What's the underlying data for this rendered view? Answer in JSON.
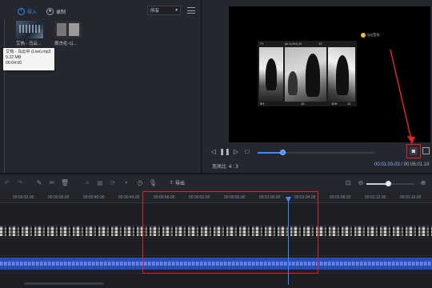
{
  "media": {
    "tabs": [
      {
        "label": "导入",
        "icon": "plus-circle-icon"
      },
      {
        "label": "录制",
        "icon": "record-circle-icon"
      }
    ],
    "filter": {
      "value": "所有",
      "icon": "chevron-down-icon"
    },
    "items": [
      {
        "name": "艾热 - 乌云..."
      },
      {
        "name": "周杰伦-以..."
      }
    ],
    "tooltip": {
      "filename": "艾热 - 乌云中 (Live).mp3",
      "size": "9.22 MB",
      "duration": "00:04:00"
    }
  },
  "preview": {
    "frame_captions": [
      "77",
      "(8-1) KO) N",
      "12",
      "9H",
      "10",
      "10H",
      "12"
    ],
    "badge": "QQ音乐",
    "aspect_label": "宽高比",
    "aspect_value": "4 : 3",
    "timecode_current": "00:01:03.03",
    "timecode_total": "00:06:01.19",
    "progress_fraction": 0.21
  },
  "timeline": {
    "export_label": "导出",
    "zoom_fraction": 0.45,
    "ticks": [
      "00:00:32.00",
      "00:00:36.00",
      "00:00:40.00",
      "00:00:44.00",
      "00:00:48.00",
      "00:00:52.00",
      "00:00:56.00",
      "00:01:00.00",
      "00:01:04.00",
      "00:01:08.00",
      "00:01:12.00",
      "00:01:16.00"
    ]
  },
  "colors": {
    "accent": "#3f88ff",
    "highlight": "#e0242a",
    "audio": "#2a4db3"
  }
}
